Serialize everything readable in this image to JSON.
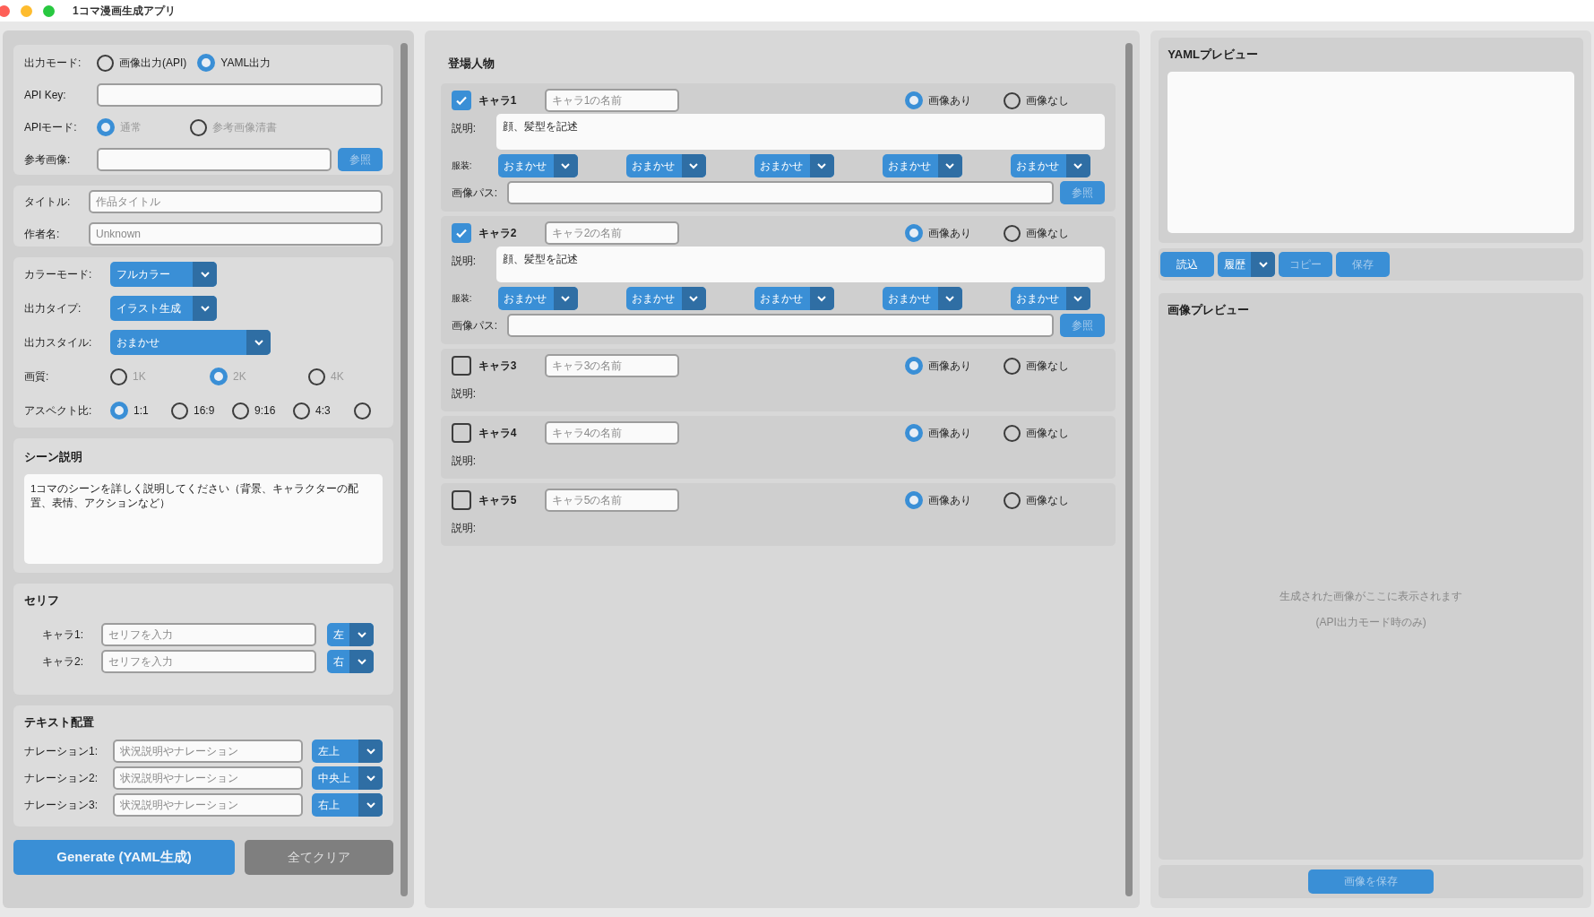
{
  "window": {
    "title": "1コマ漫画生成アプリ"
  },
  "settings": {
    "output_mode": {
      "label": "出力モード:",
      "options": [
        {
          "label": "画像出力(API)",
          "selected": false
        },
        {
          "label": "YAML出力",
          "selected": true
        }
      ]
    },
    "api_key": {
      "label": "API Key:"
    },
    "api_mode": {
      "label": "APIモード:",
      "disabled": true,
      "options": [
        {
          "label": "通常",
          "selected": true
        },
        {
          "label": "参考画像清書",
          "selected": false
        }
      ]
    },
    "reference_image": {
      "label": "参考画像:",
      "button": "参照"
    }
  },
  "meta": {
    "title": {
      "label": "タイトル:",
      "placeholder": "作品タイトル"
    },
    "author": {
      "label": "作者名:",
      "placeholder": "Unknown"
    }
  },
  "style": {
    "color_mode": {
      "label": "カラーモード:",
      "value": "フルカラー"
    },
    "output_type": {
      "label": "出力タイプ:",
      "value": "イラスト生成"
    },
    "output_style": {
      "label": "出力スタイル:",
      "value": "おまかせ"
    },
    "quality": {
      "label": "画質:",
      "disabled": true,
      "options": [
        {
          "label": "1K",
          "selected": false
        },
        {
          "label": "2K",
          "selected": true
        },
        {
          "label": "4K",
          "selected": false
        }
      ]
    },
    "aspect": {
      "label": "アスペクト比:",
      "options": [
        {
          "label": "1:1",
          "selected": true
        },
        {
          "label": "16:9",
          "selected": false
        },
        {
          "label": "9:16",
          "selected": false
        },
        {
          "label": "4:3",
          "selected": false
        },
        {
          "selected": false
        }
      ]
    }
  },
  "scene": {
    "heading": "シーン説明",
    "value": "1コマのシーンを詳しく説明してください（背景、キャラクターの配置、表情、アクションなど）"
  },
  "dialogue": {
    "heading": "セリフ",
    "rows": [
      {
        "label": "キャラ1:",
        "placeholder": "セリフを入力",
        "position": "左"
      },
      {
        "label": "キャラ2:",
        "placeholder": "セリフを入力",
        "position": "右"
      }
    ]
  },
  "text_layout": {
    "heading": "テキスト配置",
    "rows": [
      {
        "label": "ナレーション1:",
        "placeholder": "状況説明やナレーション",
        "position": "左上"
      },
      {
        "label": "ナレーション2:",
        "placeholder": "状況説明やナレーション",
        "position": "中央上"
      },
      {
        "label": "ナレーション3:",
        "placeholder": "状況説明やナレーション",
        "position": "右上"
      }
    ]
  },
  "buttons": [
    {
      "label": "Generate (YAML生成)",
      "kind": "primary"
    },
    {
      "label": "全てクリア",
      "kind": "secondary"
    }
  ],
  "characters": {
    "heading": "登場人物",
    "items": [
      {
        "name": "キャラ1",
        "checked": true,
        "placeholder": "キャラ1の名前",
        "image_options": [
          {
            "label": "画像あり",
            "selected": true
          },
          {
            "label": "画像なし",
            "selected": false
          }
        ],
        "description_label": "説明:",
        "description": "顔、髪型を記述",
        "costume_label": "服装:",
        "costumes": [
          "おまかせ",
          "おまかせ",
          "おまかせ",
          "おまかせ",
          "おまかせ"
        ],
        "path_label": "画像パス:",
        "browse": "参照"
      },
      {
        "name": "キャラ2",
        "checked": true,
        "placeholder": "キャラ2の名前",
        "image_options": [
          {
            "label": "画像あり",
            "selected": true
          },
          {
            "label": "画像なし",
            "selected": false
          }
        ],
        "description_label": "説明:",
        "description": "顔、髪型を記述",
        "costume_label": "服装:",
        "costumes": [
          "おまかせ",
          "おまかせ",
          "おまかせ",
          "おまかせ",
          "おまかせ"
        ],
        "path_label": "画像パス:",
        "browse": "参照"
      },
      {
        "name": "キャラ3",
        "checked": false,
        "placeholder": "キャラ3の名前",
        "image_options": [
          {
            "label": "画像あり",
            "selected": true
          },
          {
            "label": "画像なし",
            "selected": false
          }
        ],
        "description_label": "説明:"
      },
      {
        "name": "キャラ4",
        "checked": false,
        "placeholder": "キャラ4の名前",
        "image_options": [
          {
            "label": "画像あり",
            "selected": true
          },
          {
            "label": "画像なし",
            "selected": false
          }
        ],
        "description_label": "説明:"
      },
      {
        "name": "キャラ5",
        "checked": false,
        "placeholder": "キャラ5の名前",
        "image_options": [
          {
            "label": "画像あり",
            "selected": true
          },
          {
            "label": "画像なし",
            "selected": false
          }
        ],
        "description_label": "説明:"
      }
    ]
  },
  "yaml_preview": {
    "heading": "YAMLプレビュー"
  },
  "yaml_buttons": [
    {
      "label": "読込",
      "kind": "button",
      "disabled": false
    },
    {
      "label": "履歴",
      "kind": "dropdown",
      "disabled": false
    },
    {
      "label": "コピー",
      "kind": "button",
      "disabled": true
    },
    {
      "label": "保存",
      "kind": "button",
      "disabled": true
    }
  ],
  "image_preview": {
    "heading": "画像プレビュー",
    "message": "生成された画像がここに表示されます",
    "note": "(API出力モード時のみ)",
    "save_button": {
      "label": "画像を保存",
      "disabled": true
    }
  }
}
